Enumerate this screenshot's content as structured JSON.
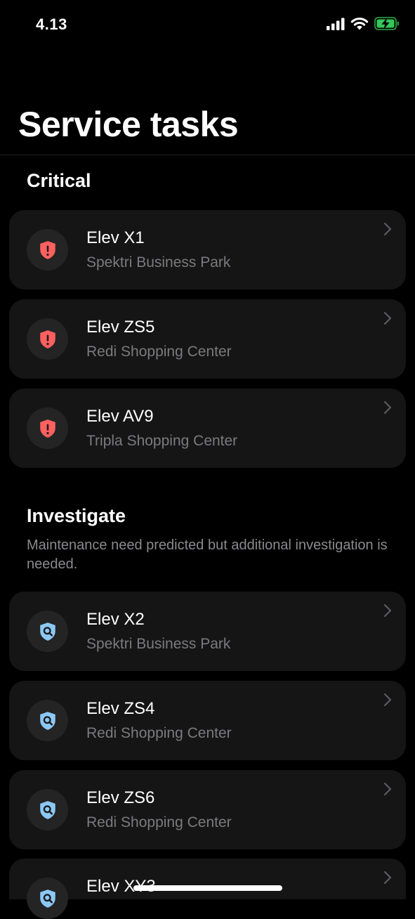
{
  "status_bar": {
    "time": "4.13"
  },
  "page": {
    "title": "Service tasks"
  },
  "sections": {
    "critical": {
      "title": "Critical",
      "items": [
        {
          "name": "Elev X1",
          "location": "Spektri Business Park"
        },
        {
          "name": "Elev ZS5",
          "location": "Redi Shopping Center"
        },
        {
          "name": "Elev AV9",
          "location": "Tripla Shopping Center"
        }
      ]
    },
    "investigate": {
      "title": "Investigate",
      "description": "Maintenance need predicted but additional investigation is needed.",
      "items": [
        {
          "name": "Elev X2",
          "location": "Spektri Business Park"
        },
        {
          "name": "Elev ZS4",
          "location": "Redi Shopping Center"
        },
        {
          "name": "Elev ZS6",
          "location": "Redi Shopping Center"
        },
        {
          "name": "Elev XY3",
          "location": ""
        }
      ]
    }
  },
  "icons": {
    "critical": "shield-exclamation-icon",
    "investigate": "shield-search-icon",
    "chevron": "chevron-right-icon"
  },
  "colors": {
    "critical": "#ff6060",
    "investigate": "#8cc8f5",
    "card_background": "#151515",
    "secondary_text": "#7b7b7f"
  }
}
